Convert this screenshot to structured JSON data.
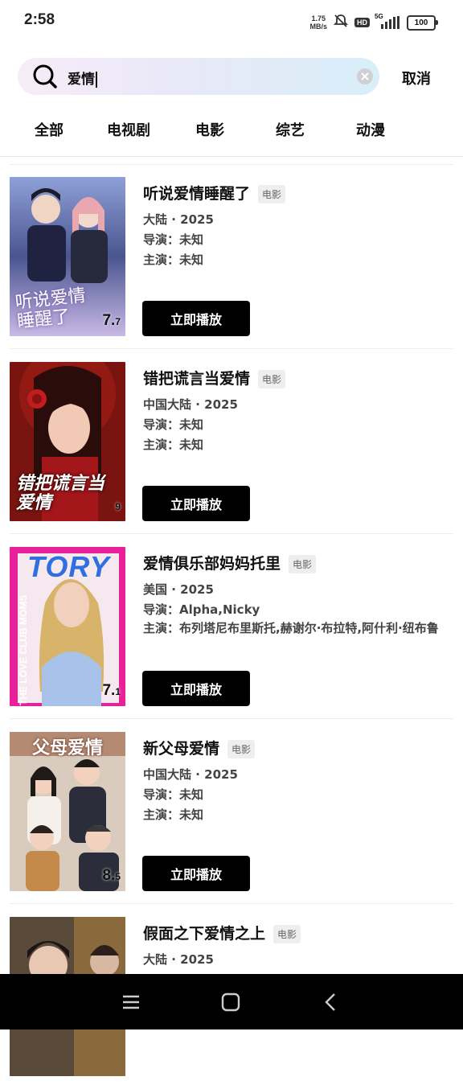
{
  "status": {
    "time": "2:58",
    "net_speed_value": "1.75",
    "net_speed_unit": "MB/s",
    "hd": "HD",
    "signal": "5G",
    "battery": "100"
  },
  "search": {
    "query": "爱情",
    "cancel_label": "取消"
  },
  "tabs": [
    {
      "label": "全部"
    },
    {
      "label": "电视剧"
    },
    {
      "label": "电影"
    },
    {
      "label": "综艺"
    },
    {
      "label": "动漫"
    }
  ],
  "results": [
    {
      "title": "听说爱情睡醒了",
      "type": "电影",
      "region_year": "大陆 · 2025",
      "director": "导演：未知",
      "cast": "主演：未知",
      "rating_int": "7.",
      "rating_dec": "7",
      "poster_text": "听说爱情睡醒了",
      "play_label": "立即播放"
    },
    {
      "title": "错把谎言当爱情",
      "type": "电影",
      "region_year": "中国大陆 · 2025",
      "director": "导演：未知",
      "cast": "主演：未知",
      "rating_int": "",
      "rating_dec": "9",
      "poster_text": "错把谎言当爱情",
      "play_label": "立即播放"
    },
    {
      "title": "爱情俱乐部妈妈托里",
      "type": "电影",
      "region_year": "美国 · 2025",
      "director": "导演：Alpha,Nicky",
      "cast": "主演：布列塔尼布里斯托,赫谢尔·布拉特,阿什利·纽布鲁",
      "rating_int": "7.",
      "rating_dec": "1",
      "poster_text": "TORY",
      "poster_subtext": "THE LOVE CLUB MOMS",
      "play_label": "立即播放"
    },
    {
      "title": "新父母爱情",
      "type": "电影",
      "region_year": "中国大陆 · 2025",
      "director": "导演：未知",
      "cast": "主演：未知",
      "rating_int": "8.",
      "rating_dec": "5",
      "poster_text": "父母爱情",
      "play_label": "立即播放"
    },
    {
      "title": "假面之下爱情之上",
      "type": "电影",
      "region_year": "大陆 · 2025",
      "director": "",
      "cast": "",
      "play_label": ""
    }
  ],
  "colors": {
    "accent": "#000000",
    "search_gradient_start": "#f7ecf8",
    "search_gradient_end": "#d9eef9",
    "poster3_bg": "#e8209a"
  },
  "icons": {
    "search": "search-icon",
    "clear": "clear-icon",
    "nav_menu": "menu-icon",
    "nav_home": "home-icon",
    "nav_back": "back-icon"
  }
}
